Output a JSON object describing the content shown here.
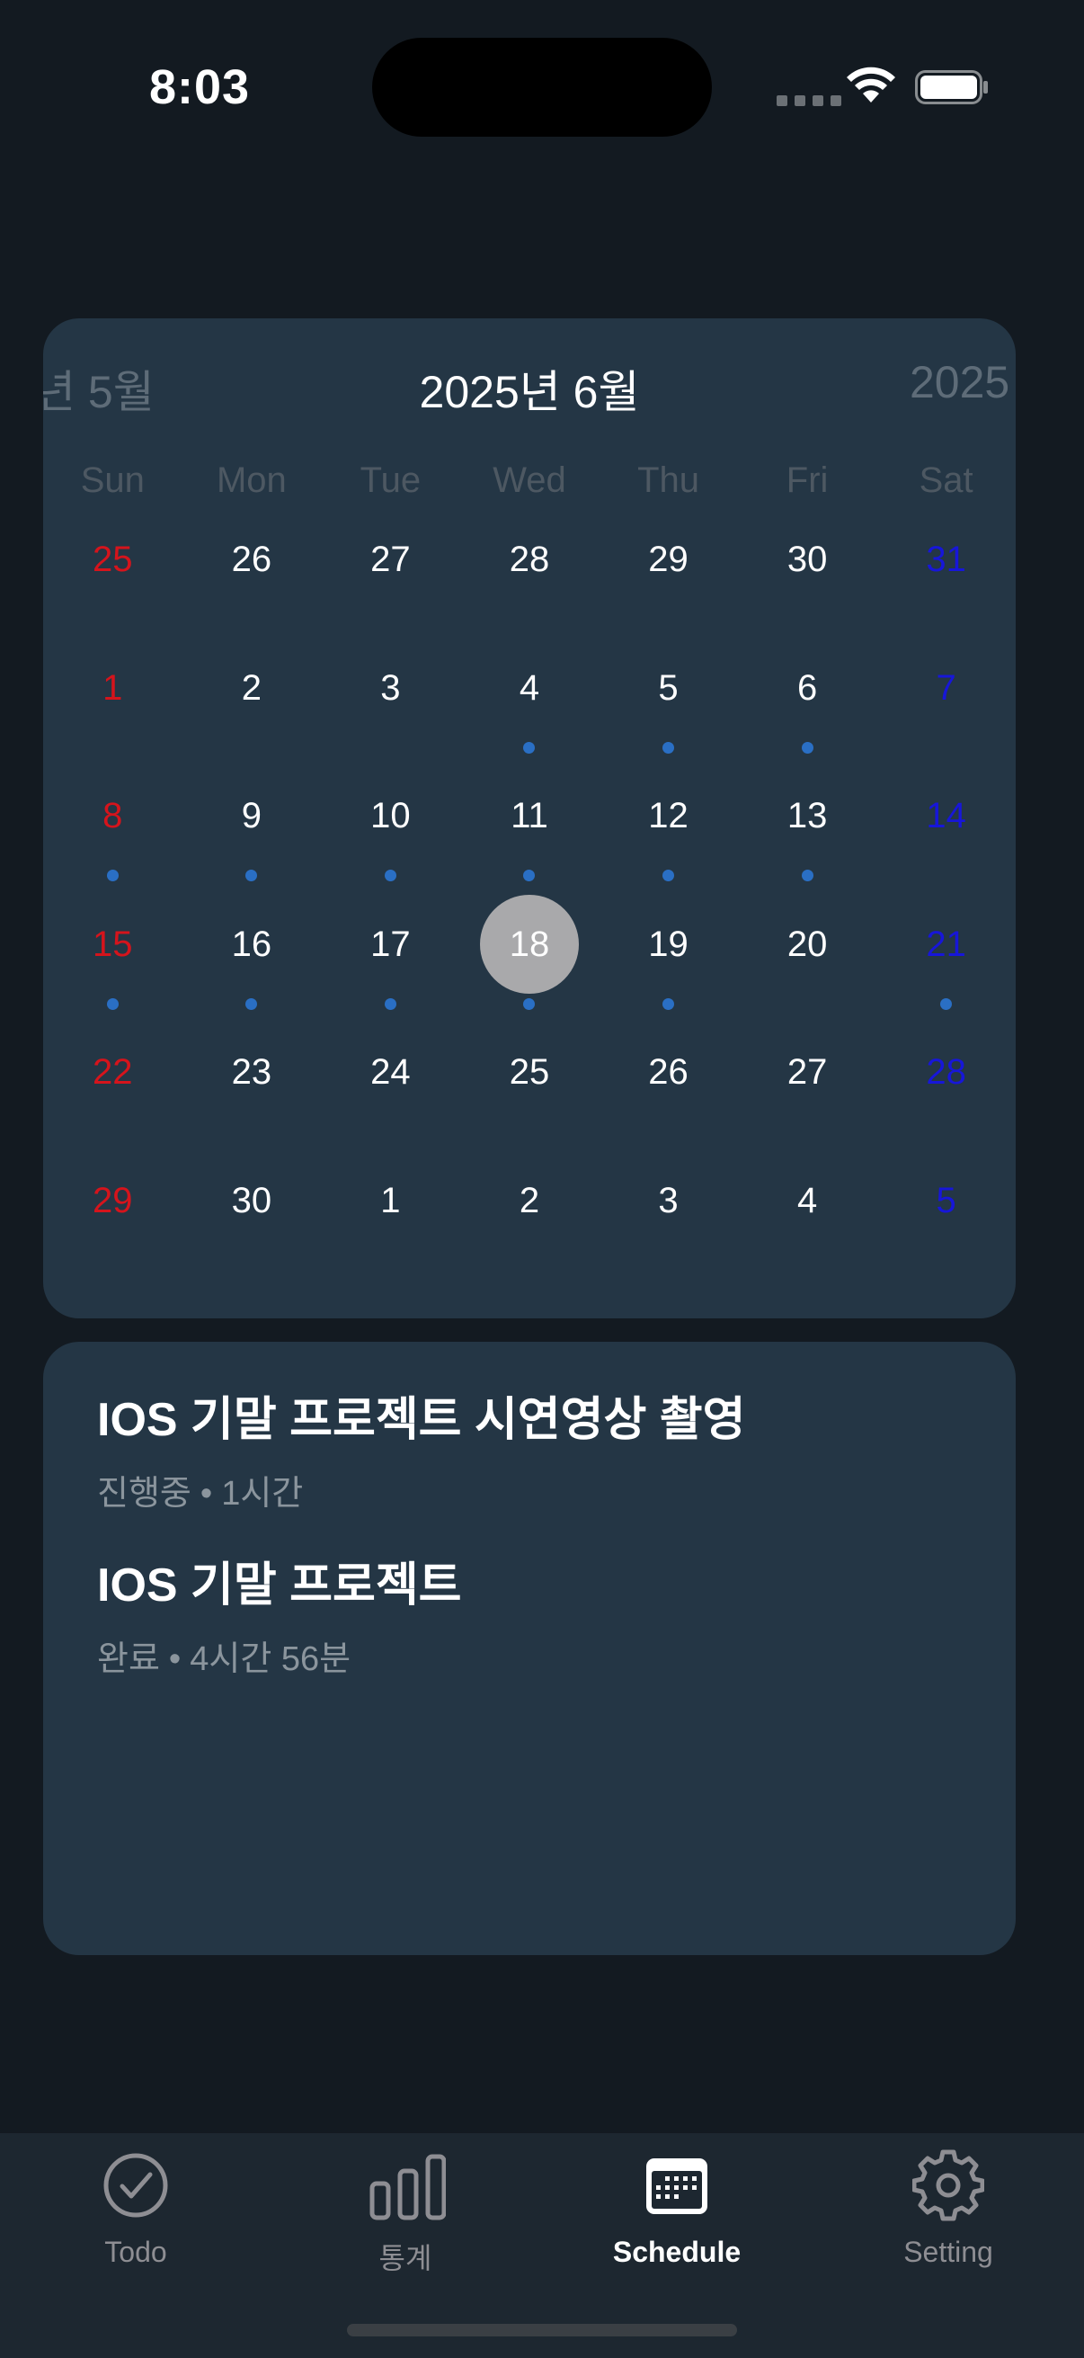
{
  "status_bar": {
    "time": "8:03"
  },
  "calendar": {
    "prev_month": "년 5월",
    "current_month": "2025년 6월",
    "next_month": "2025",
    "weekdays": [
      "Sun",
      "Mon",
      "Tue",
      "Wed",
      "Thu",
      "Fri",
      "Sat"
    ],
    "weeks": [
      [
        "25",
        "26",
        "27",
        "28",
        "29",
        "30",
        "31"
      ],
      [
        "1",
        "2",
        "3",
        "4",
        "5",
        "6",
        "7"
      ],
      [
        "8",
        "9",
        "10",
        "11",
        "12",
        "13",
        "14"
      ],
      [
        "15",
        "16",
        "17",
        "18",
        "19",
        "20",
        "21"
      ],
      [
        "22",
        "23",
        "24",
        "25",
        "26",
        "27",
        "28"
      ],
      [
        "29",
        "30",
        "1",
        "2",
        "3",
        "4",
        "5"
      ]
    ],
    "event_days": [
      "4",
      "5",
      "6",
      "8",
      "9",
      "10",
      "11",
      "12",
      "13",
      "15",
      "16",
      "17",
      "18",
      "19",
      "21"
    ],
    "selected_day": "18",
    "colors": {
      "sunday": "#d5141c",
      "saturday": "#1716d9",
      "event_dot": "#2a6fc4",
      "selected_bg": "#a9a9ab"
    }
  },
  "schedule": {
    "items": [
      {
        "title": "IOS 기말 프로젝트 시연영상 촬영",
        "status": "진행중",
        "separator": "•",
        "duration": "1시간"
      },
      {
        "title": "IOS 기말 프로젝트",
        "status": "완료",
        "separator": "•",
        "duration": "4시간 56분"
      }
    ]
  },
  "tab_bar": {
    "tabs": [
      {
        "label": "Todo",
        "icon": "checkmark-circle-icon"
      },
      {
        "label": "통계",
        "icon": "bar-chart-icon"
      },
      {
        "label": "Schedule",
        "icon": "calendar-icon",
        "active": true
      },
      {
        "label": "Setting",
        "icon": "gear-icon"
      }
    ]
  }
}
